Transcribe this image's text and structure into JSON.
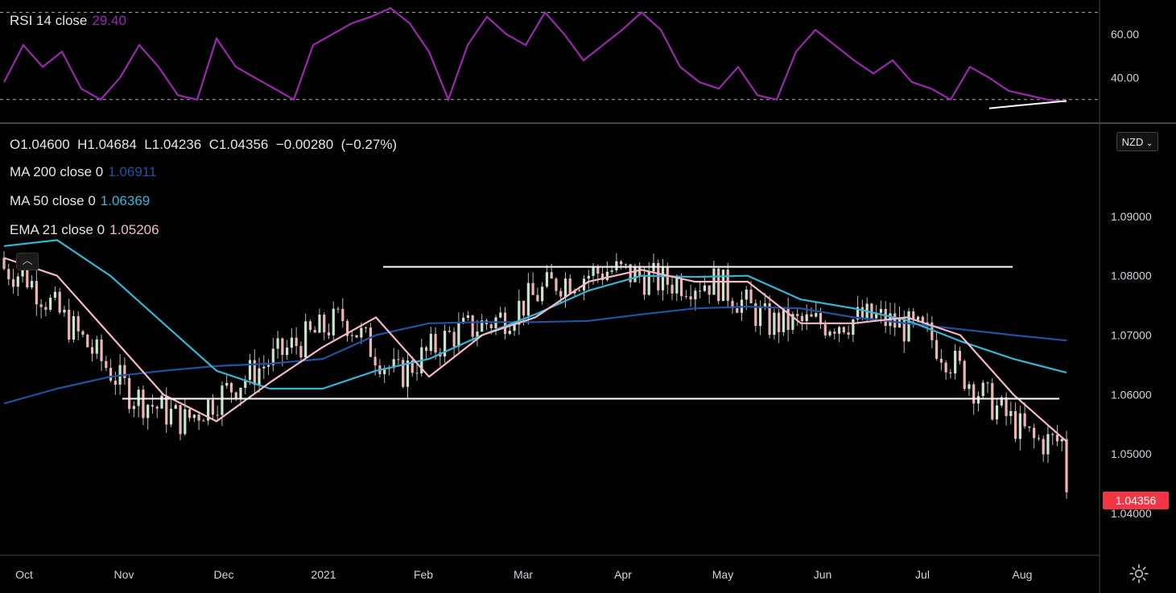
{
  "rsi": {
    "label": "RSI 14 close",
    "value": "29.40",
    "value_color": "#9c27b0",
    "ticks": [
      "60.00",
      "40.00"
    ]
  },
  "main": {
    "ohlc": "O1.04600  H1.04684  L1.04236  C1.04356  −0.00280  (−0.27%)",
    "ma200": {
      "label": "MA 200 close 0",
      "value": "1.06911",
      "color": "#1e53a6"
    },
    "ma50": {
      "label": "MA 50 close 0",
      "value": "1.06369",
      "color": "#2eb8d8"
    },
    "ema21": {
      "label": "EMA 21 close 0",
      "value": "1.05206",
      "color": "#f5b8c8"
    },
    "currency": "NZD",
    "last_price": "1.04356",
    "last_price_color": "#f23645"
  },
  "chart_data": [
    {
      "type": "line",
      "title": "RSI 14 close",
      "ylim": [
        24,
        72
      ],
      "y_ticks": [
        60,
        40
      ],
      "levels": [
        70,
        30
      ],
      "series": [
        {
          "name": "RSI 14 close",
          "values": [
            38,
            55,
            45,
            52,
            35,
            30,
            40,
            55,
            45,
            32,
            30,
            58,
            45,
            40,
            35,
            30,
            55,
            60,
            65,
            68,
            72,
            65,
            52,
            30,
            55,
            68,
            60,
            55,
            70,
            60,
            48,
            55,
            62,
            70,
            62,
            45,
            38,
            35,
            45,
            32,
            30,
            52,
            62,
            55,
            48,
            42,
            48,
            38,
            35,
            30,
            45,
            40,
            34,
            32,
            30,
            29
          ]
        }
      ],
      "trendline": {
        "from": [
          51,
          26
        ],
        "to": [
          55,
          29.4
        ]
      }
    },
    {
      "type": "candlestick",
      "x_labels": [
        "Oct",
        "Nov",
        "Dec",
        "2021",
        "Feb",
        "Mar",
        "Apr",
        "May",
        "Jun",
        "Jul",
        "Aug"
      ],
      "y_ticks": [
        "1.09000",
        "1.08000",
        "1.07000",
        "1.06000",
        "1.05000",
        "1.04000"
      ],
      "ylim": [
        1.035,
        1.1
      ],
      "horizontal_lines": [
        1.0815,
        1.0593
      ],
      "series": [
        {
          "name": "MA 200 close 0",
          "values": [
            1.0585,
            1.061,
            1.063,
            1.064,
            1.0648,
            1.0652,
            1.066,
            1.07,
            1.072,
            1.0722,
            1.0722,
            1.0724,
            1.0735,
            1.0745,
            1.0748,
            1.0745,
            1.073,
            1.072,
            1.071,
            1.07,
            1.0691
          ]
        },
        {
          "name": "MA 50 close 0",
          "values": [
            1.085,
            1.086,
            1.08,
            1.072,
            1.064,
            1.061,
            1.061,
            1.064,
            1.066,
            1.07,
            1.0735,
            1.0775,
            1.08,
            1.0798,
            1.08,
            1.076,
            1.0745,
            1.0725,
            1.069,
            1.066,
            1.0637
          ]
        },
        {
          "name": "EMA 21 close 0",
          "values": [
            1.083,
            1.08,
            1.07,
            1.06,
            1.0555,
            1.062,
            1.068,
            1.073,
            1.063,
            1.07,
            1.073,
            1.079,
            1.081,
            1.079,
            1.079,
            1.072,
            1.072,
            1.073,
            1.07,
            1.06,
            1.0521
          ]
        }
      ],
      "last_close": 1.04356
    }
  ]
}
